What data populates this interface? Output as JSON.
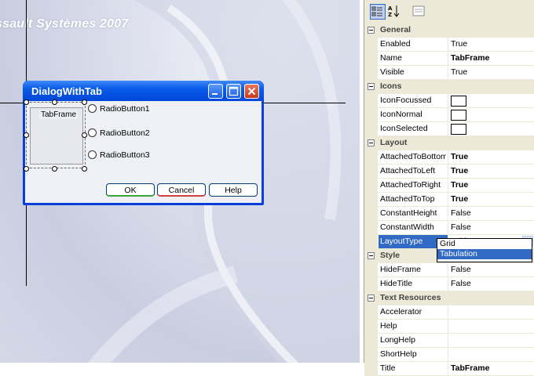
{
  "watermark": "ssault Systèmes 2007",
  "dialog": {
    "title": "DialogWithTab",
    "frame_label": "TabFrame",
    "radios": [
      "RadioButton1",
      "RadioButton2",
      "RadioButton3"
    ],
    "buttons": {
      "ok": "OK",
      "cancel": "Cancel",
      "help": "Help"
    }
  },
  "props": {
    "rows": [
      {
        "kind": "cat",
        "name": "General"
      },
      {
        "name": "Enabled",
        "value": "True"
      },
      {
        "name": "Name",
        "value": "TabFrame",
        "bold": true
      },
      {
        "name": "Visible",
        "value": "True"
      },
      {
        "kind": "cat",
        "name": "Icons"
      },
      {
        "name": "IconFocussed",
        "value": "",
        "swatch": true
      },
      {
        "name": "IconNormal",
        "value": "",
        "swatch": true
      },
      {
        "name": "IconSelected",
        "value": "",
        "swatch": true
      },
      {
        "kind": "cat",
        "name": "Layout"
      },
      {
        "name": "AttachedToBottom",
        "value": "True",
        "bold": true
      },
      {
        "name": "AttachedToLeft",
        "value": "True",
        "bold": true
      },
      {
        "name": "AttachedToRight",
        "value": "True",
        "bold": true
      },
      {
        "name": "AttachedToTop",
        "value": "True",
        "bold": true
      },
      {
        "name": "ConstantHeight",
        "value": "False"
      },
      {
        "name": "ConstantWidth",
        "value": "False"
      },
      {
        "name": "LayoutType",
        "value": "Grid",
        "selected": true,
        "dropdown": true
      },
      {
        "kind": "cat",
        "name": "Style"
      },
      {
        "name": "HideFrame",
        "value": "False"
      },
      {
        "name": "HideTitle",
        "value": "False"
      },
      {
        "kind": "cat",
        "name": "Text Resources"
      },
      {
        "name": "Accelerator",
        "value": ""
      },
      {
        "name": "Help",
        "value": ""
      },
      {
        "name": "LongHelp",
        "value": ""
      },
      {
        "name": "ShortHelp",
        "value": ""
      },
      {
        "name": "Title",
        "value": "TabFrame",
        "bold": true
      }
    ],
    "dropdown_options": [
      "Grid",
      "Tabulation"
    ],
    "dropdown_highlighted": "Tabulation"
  }
}
